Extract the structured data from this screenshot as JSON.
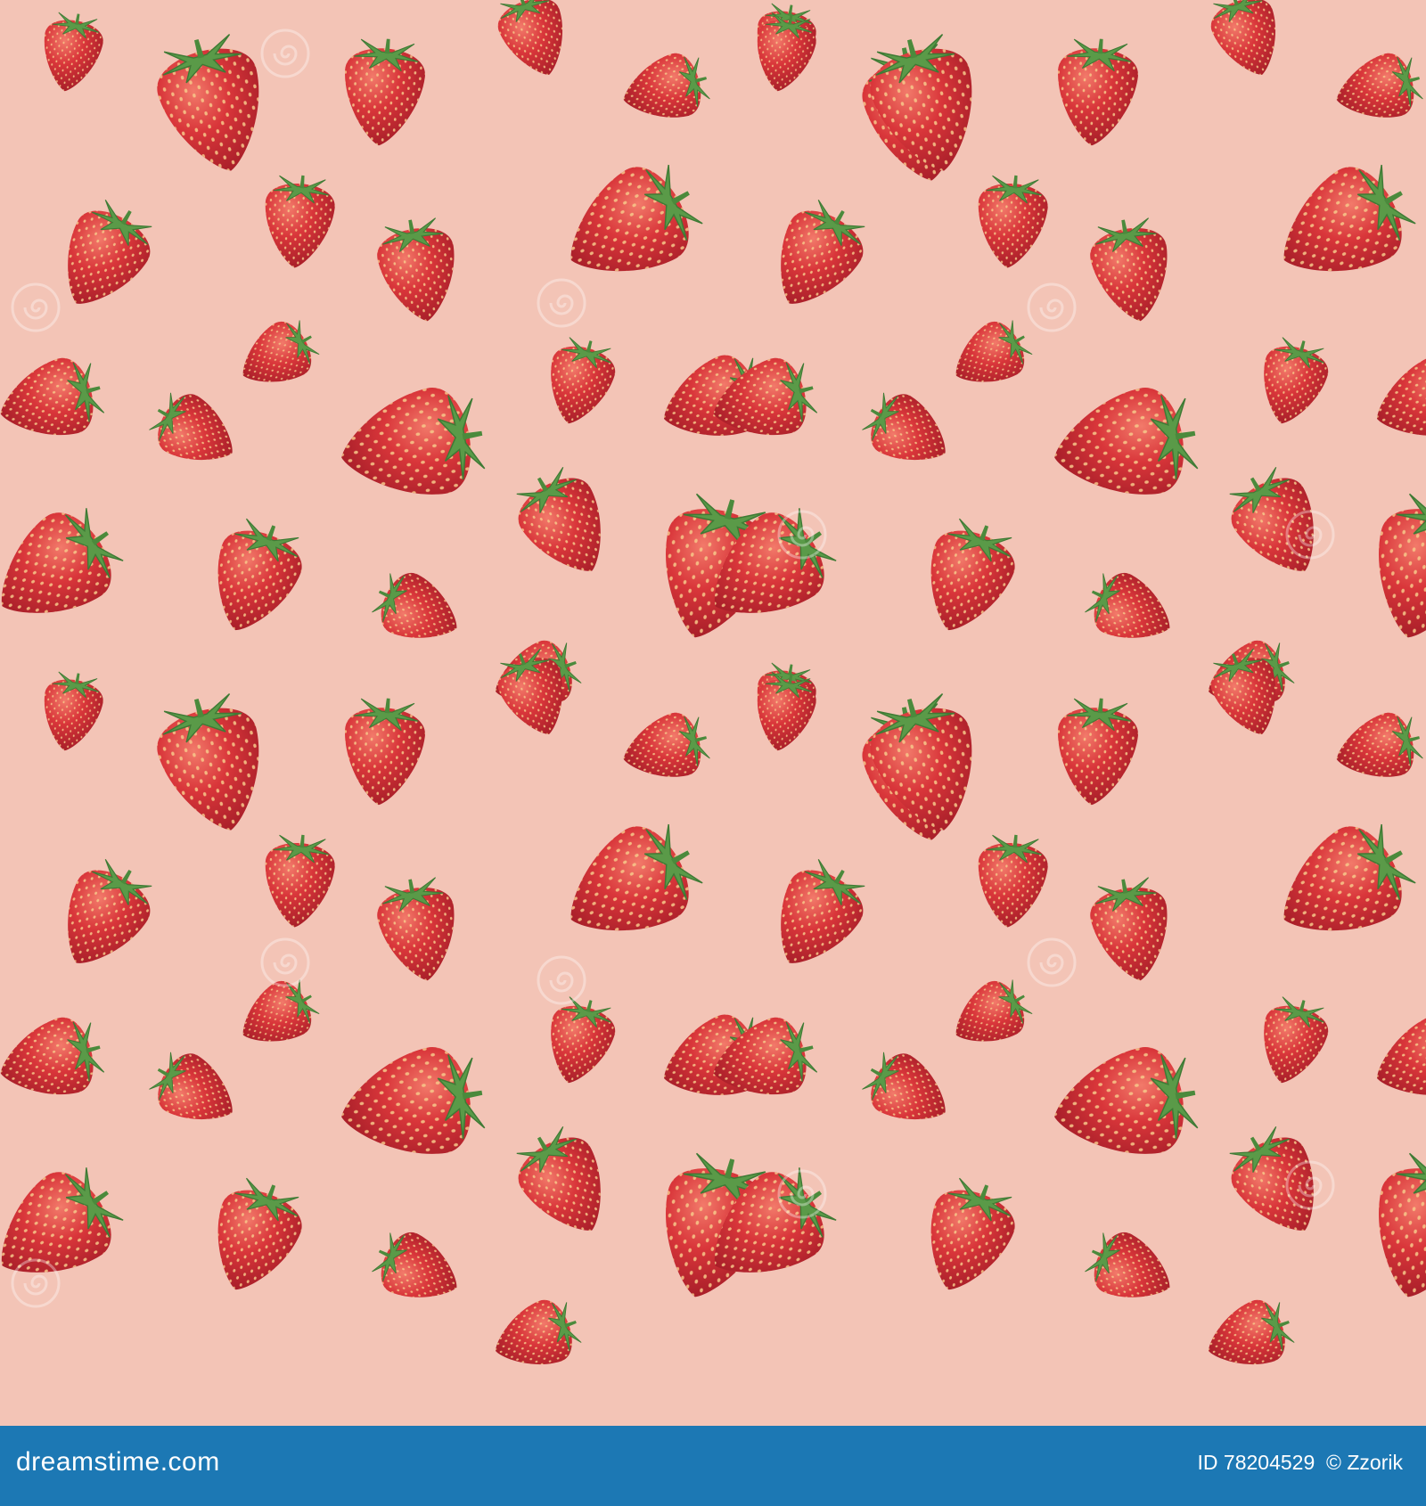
{
  "image": {
    "subject": "watercolor strawberry pattern",
    "icon": "strawberry-icon",
    "colors": {
      "background": "#f3c4b6",
      "berry": "#d33a3a",
      "berry_dark": "#a8202a",
      "berry_light": "#ef6b5e",
      "seed": "#f7c98a",
      "leaf": "#5a9a48",
      "leaf_light": "#8bc06a",
      "watermark": "#ffffff",
      "footer": "#1c78b4"
    }
  },
  "footer": {
    "brand": "dreamstime.com",
    "id_label": "ID",
    "id_number": "78204529",
    "copyright_symbol": "©",
    "author": "Zzorik"
  }
}
